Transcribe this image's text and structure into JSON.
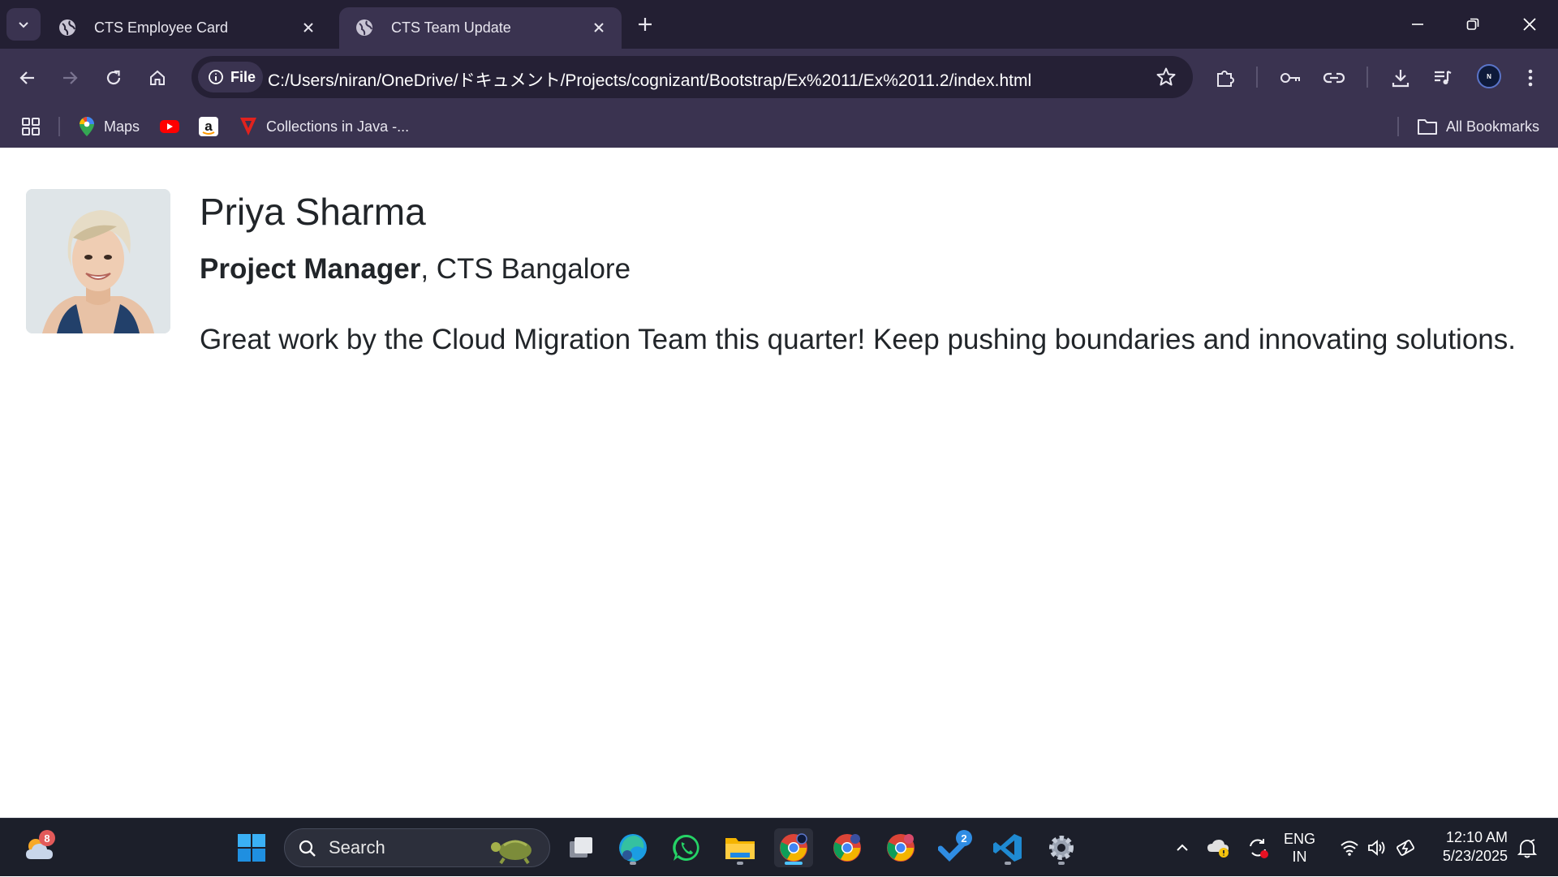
{
  "browser": {
    "tabs": [
      {
        "title": "CTS Employee Card",
        "active": false
      },
      {
        "title": "CTS Team Update",
        "active": true
      }
    ],
    "address": {
      "scheme_chip": "File",
      "url": "C:/Users/niran/OneDrive/ドキュメント/Projects/cognizant/Bootstrap/Ex%2011/Ex%2011.2/index.html"
    },
    "profile_initial": "N",
    "bookmarks": [
      {
        "label": "Maps",
        "icon": "maps-icon"
      },
      {
        "label": "",
        "icon": "youtube-icon"
      },
      {
        "label": "",
        "icon": "amazon-icon"
      },
      {
        "label": "Collections in Java -...",
        "icon": "tricentis-icon"
      }
    ],
    "all_bookmarks": "All Bookmarks"
  },
  "page": {
    "name": "Priya Sharma",
    "role": "Project Manager",
    "location": ", CTS Bangalore",
    "message": "Great work by the Cloud Migration Team this quarter! Keep pushing boundaries and innovating solutions."
  },
  "taskbar": {
    "weather_badge": "8",
    "search_placeholder": "Search",
    "todo_badge": "2",
    "language": "ENG",
    "region": "IN",
    "time": "12:10 AM",
    "date": "5/23/2025"
  },
  "colors": {
    "tabstrip": "#231f33",
    "toolbar": "#3a3350",
    "omnibox": "#252035",
    "taskbar": "#1c1f2a",
    "text": "#212529"
  }
}
